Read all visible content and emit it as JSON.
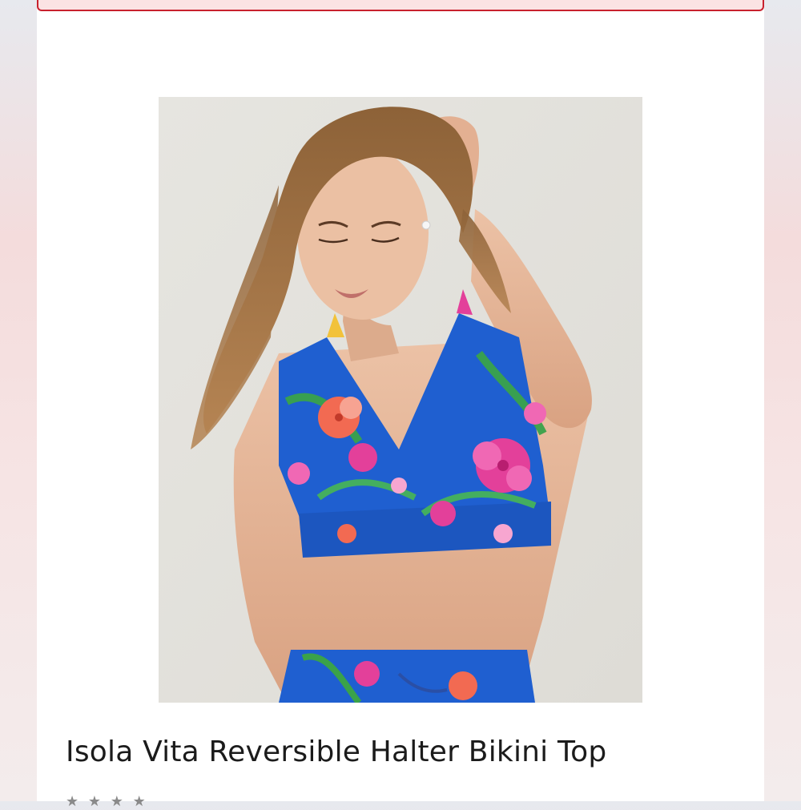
{
  "product": {
    "title": "Isola Vita Reversible Halter Bikini Top",
    "image_alt": "Model wearing a blue tropical floral print halter bikini top",
    "image_colors": {
      "background": "#e4e3de",
      "fabric": "#1f5fd0",
      "flower_pink": "#e3409a",
      "flower_coral": "#f26a52",
      "leaf_green": "#3aa24a",
      "hair": "#9a6a3e",
      "skin": "#e2b196"
    }
  },
  "banner": {
    "border_color": "#c8212e"
  }
}
